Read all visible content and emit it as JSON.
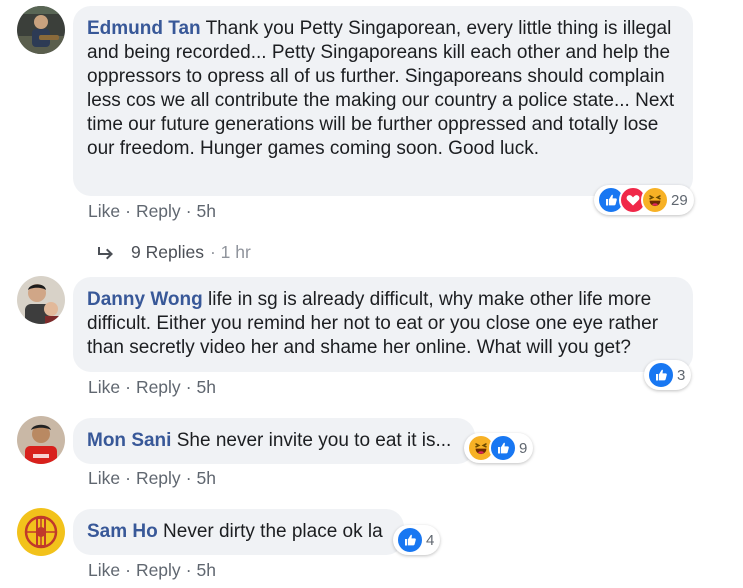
{
  "comments": [
    {
      "author": "Edmund Tan",
      "text": "Thank you Petty Singaporean, every little thing is illegal and being recorded... Petty Singaporeans kill each other and help the oppressors to opress all of us further. Singaporeans should complain less cos we all contribute the making our country a police state... Next time our future generations will be further oppressed and totally lose our freedom. Hunger games coming soon. Good luck.",
      "like": "Like",
      "reply": "Reply",
      "time": "5h",
      "reactions": [
        "like-icon",
        "love-icon",
        "haha-icon"
      ],
      "reaction_count": "29",
      "replies_label": "9 Replies",
      "replies_time": "1 hr"
    },
    {
      "author": "Danny Wong",
      "text": "life in sg is already difficult, why make other life more difficult. Either you remind her not to eat or you close one eye rather than secretly video her and shame her online. What will you get?",
      "like": "Like",
      "reply": "Reply",
      "time": "5h",
      "reactions": [
        "like-icon"
      ],
      "reaction_count": "3"
    },
    {
      "author": "Mon Sani",
      "text": "She never invite you to eat it is...",
      "like": "Like",
      "reply": "Reply",
      "time": "5h",
      "reactions": [
        "haha-icon",
        "like-icon"
      ],
      "reaction_count": "9"
    },
    {
      "author": "Sam Ho",
      "text": "Never dirty the place ok la",
      "like": "Like",
      "reply": "Reply",
      "time": "5h",
      "reactions": [
        "like-icon"
      ],
      "reaction_count": "4"
    }
  ],
  "colors": {
    "author": "#385898",
    "bubble": "#f0f2f5",
    "like_blue": "#1877f2",
    "love_red": "#f02849",
    "haha_yellow": "#f7b125"
  }
}
